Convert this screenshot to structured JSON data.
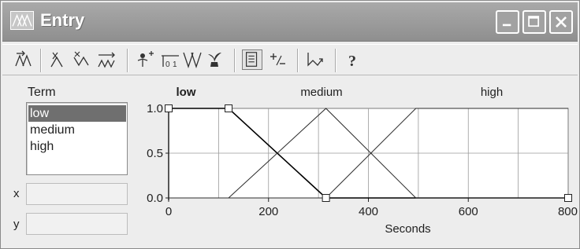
{
  "window": {
    "title": "Entry",
    "app_icon": "fuzzy-set-icon"
  },
  "titlebar_buttons": [
    {
      "name": "minimize",
      "icon": "minimize-icon"
    },
    {
      "name": "maximize",
      "icon": "maximize-icon"
    },
    {
      "name": "close",
      "icon": "close-icon"
    }
  ],
  "toolbar": {
    "groups": [
      [
        "add-term-icon",
        "edit-term-icon",
        "add-shape-icon",
        "staircase-icon"
      ],
      [
        "move-point-icon",
        "insert-point-icon",
        "mirror-term-icon",
        "plant-icon"
      ],
      [
        "term-list-icon",
        "plus-minus-icon"
      ],
      [
        "curve-icon"
      ],
      [
        "help-icon"
      ]
    ]
  },
  "terms": {
    "label": "Term",
    "items": [
      "low",
      "medium",
      "high"
    ],
    "selected": "low"
  },
  "fields": {
    "x_label": "x",
    "y_label": "y",
    "x_value": "",
    "y_value": ""
  },
  "chart_data": {
    "type": "line",
    "xlabel": "Seconds",
    "ylabel": "",
    "xlim": [
      0,
      800
    ],
    "ylim": [
      0,
      1
    ],
    "x_ticks": [
      0,
      200,
      400,
      600,
      800
    ],
    "y_ticks": [
      0.0,
      0.5,
      1.0
    ],
    "x_tick_labels": [
      "0",
      "200",
      "400",
      "600",
      "800"
    ],
    "y_tick_labels": [
      "0.0",
      "0.5",
      "1.0"
    ],
    "grid": true,
    "term_headers": [
      {
        "label": "low",
        "bold": true
      },
      {
        "label": "medium",
        "bold": false
      },
      {
        "label": "high",
        "bold": false
      }
    ],
    "series": [
      {
        "name": "low",
        "points": [
          [
            0,
            1.0
          ],
          [
            120,
            1.0
          ],
          [
            315,
            0.0
          ],
          [
            800,
            0.0
          ]
        ]
      },
      {
        "name": "medium",
        "points": [
          [
            0,
            0.0
          ],
          [
            120,
            0.0
          ],
          [
            315,
            1.0
          ],
          [
            495,
            0.0
          ],
          [
            800,
            0.0
          ]
        ]
      },
      {
        "name": "high",
        "points": [
          [
            0,
            0.0
          ],
          [
            315,
            0.0
          ],
          [
            495,
            1.0
          ],
          [
            800,
            1.0
          ]
        ]
      }
    ],
    "handle_points": [
      [
        0,
        1.0
      ],
      [
        120,
        1.0
      ],
      [
        315,
        0.0
      ],
      [
        800,
        0.0
      ]
    ]
  },
  "colors": {
    "titlebar": "#999999",
    "selected_bg": "#6f6f6f",
    "selected_fg": "#ffffff",
    "grid": "#9a9a9a",
    "line": "#2b2b2b",
    "active_line": "#000000"
  }
}
